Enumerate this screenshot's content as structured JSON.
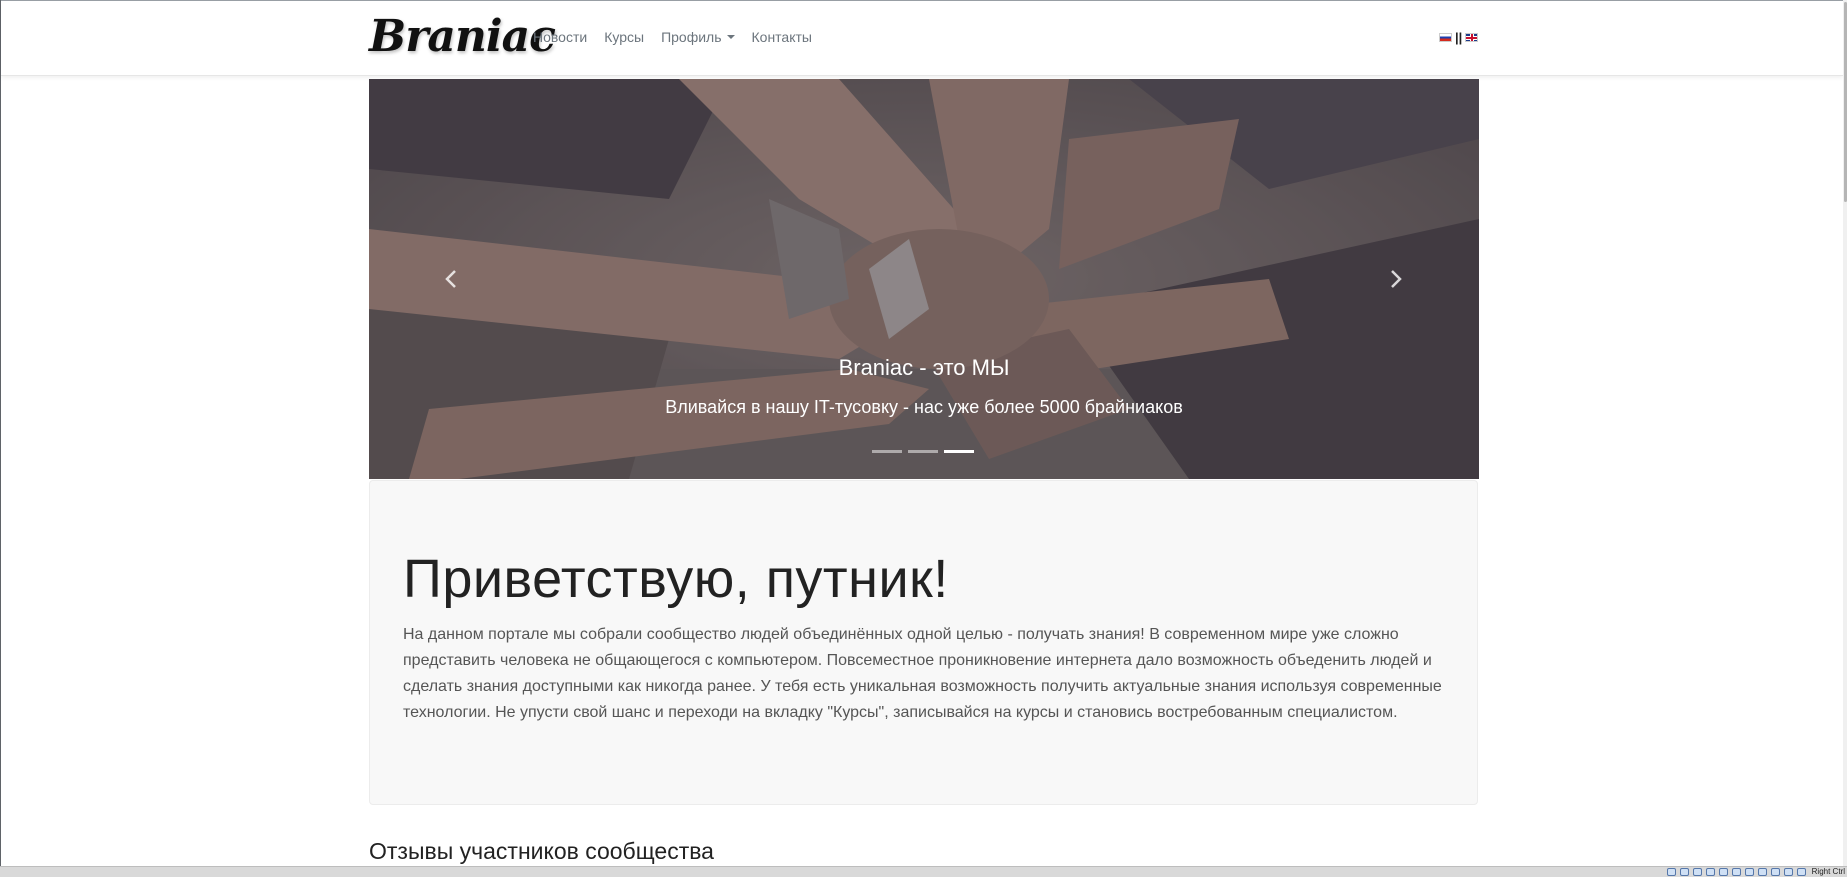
{
  "brand": "Braniac",
  "nav": {
    "news": "Новости",
    "courses": "Курсы",
    "profile": "Профиль",
    "contacts": "Контакты"
  },
  "lang": {
    "separator": "||"
  },
  "carousel": {
    "title": "Braniac - это МЫ",
    "text": "Вливайся в нашу IT-тусовку - нас уже более 5000 брайниаков",
    "slides_count": 3,
    "active_slide": 3
  },
  "jumbotron": {
    "title": "Приветствую, путник!",
    "text": "На данном портале мы собрали сообщество людей объединённых одной целью - получать знания! В современном мире уже сложно представить человека не общающегося с компьютером. Повсеместное проникновение интернета дало возможность объеденить людей и сделать знания доступными как никогда ранее. У тебя есть уникальная возможность получить актуальные знания используя современные технологии. Не упусти свой шанс и переходи на вкладку \"Курсы\", записывайся на курсы и становись востребованным специалистом."
  },
  "reviews": {
    "title": "Отзывы участников сообщества"
  },
  "statusbar": {
    "host_key": "Right Ctrl"
  }
}
